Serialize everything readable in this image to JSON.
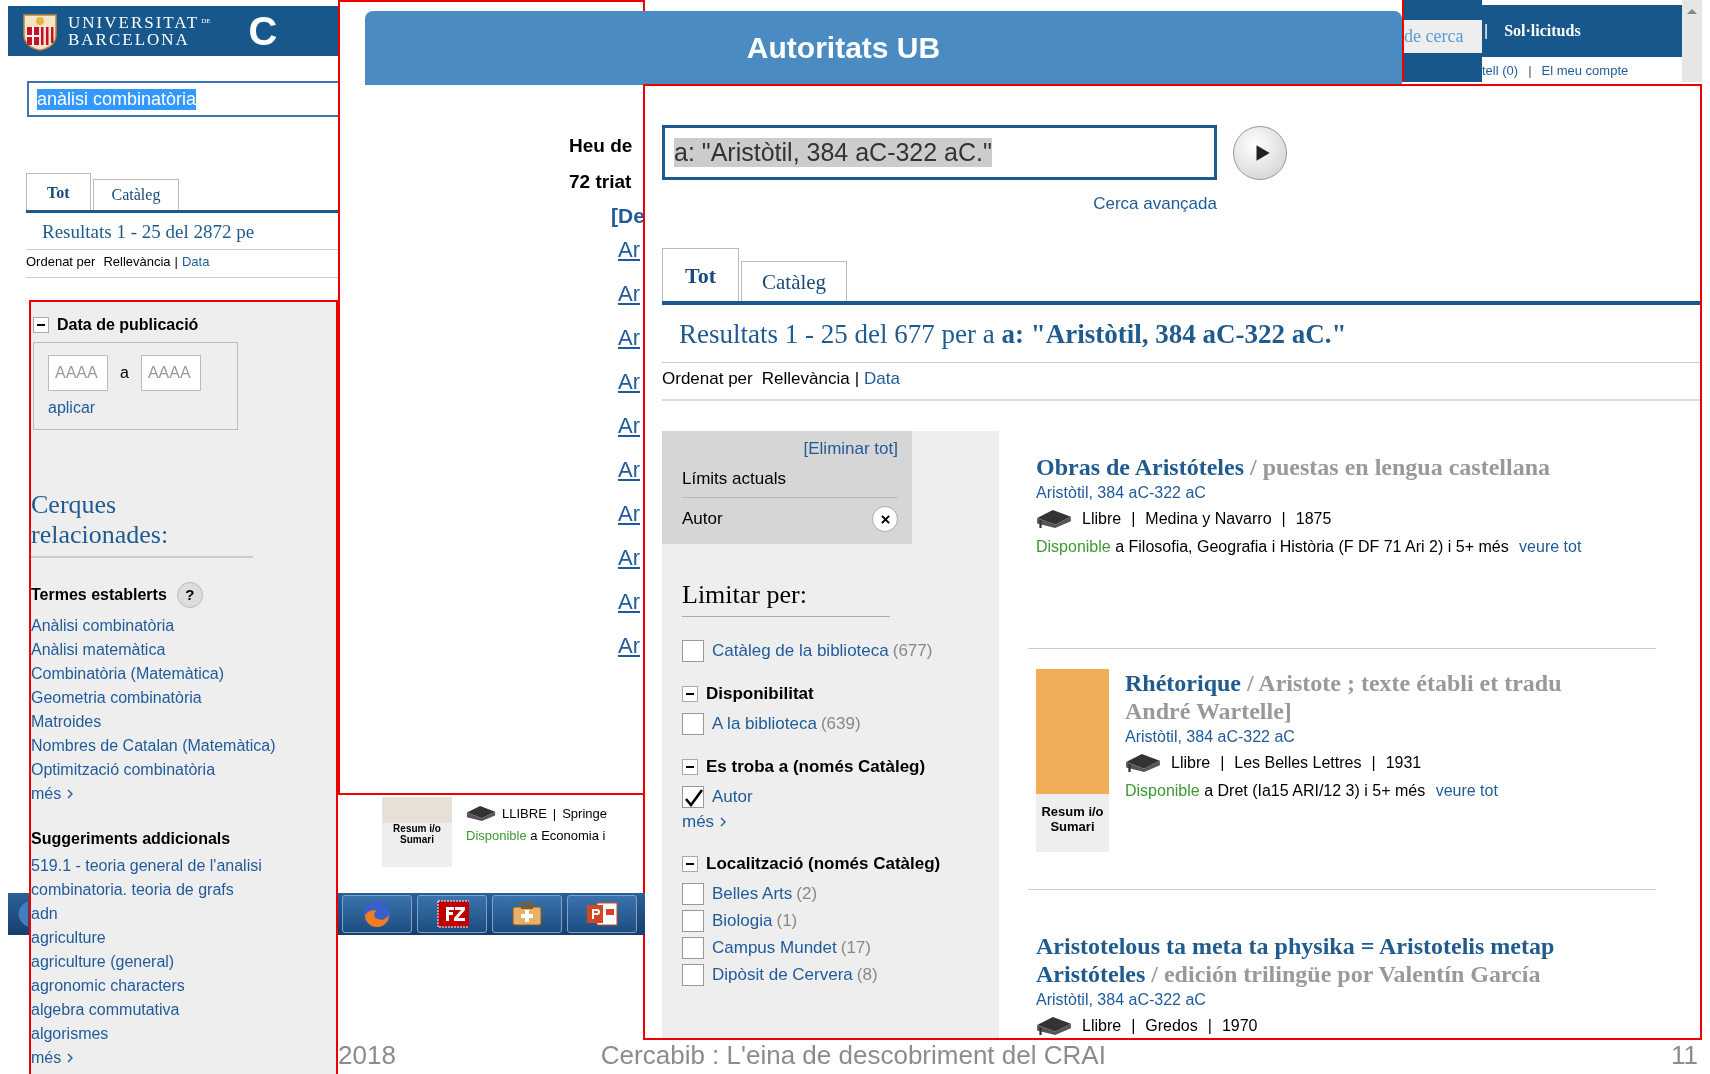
{
  "left_window": {
    "logo_lines": [
      "UNIVERSITAT",
      "DE",
      "BARCELONA"
    ],
    "brand_cut": "C",
    "search": {
      "value": "anàlisi combinatòria",
      "text_selected": true
    },
    "tabs": [
      {
        "label": "Tot",
        "selected": true
      },
      {
        "label": "Catàleg",
        "selected": false
      }
    ],
    "results_heading": "Resultats 1 - 25 del 2872 pe",
    "sort": {
      "label": "Ordenat per",
      "separator": "|",
      "options": [
        {
          "label": "Rellevància",
          "selected": true
        },
        {
          "label": "Data",
          "selected": false
        }
      ]
    },
    "date_facet": {
      "title": "Data de publicació",
      "expanded": true,
      "from_placeholder": "AAAA",
      "between": "a",
      "to_placeholder": "AAAA",
      "apply": "aplicar"
    },
    "related_heading": "Cerques relacionades:",
    "related_groups": [
      {
        "title": "Termes establerts",
        "help": "?",
        "links": [
          "Anàlisi combinatòria",
          "Anàlisi matemàtica",
          "Combinatòria (Matemàtica)",
          "Geometria combinatòria",
          "Matroides",
          "Nombres de Catalan (Matemàtica)",
          "Optimització combinatòria"
        ],
        "more": "més"
      },
      {
        "title": "Suggeriments addicionals",
        "links": [
          "519.1 - teoria general de l'analisi combinatoria. teoria de grafs",
          "adn",
          "agriculture",
          "agriculture (general)",
          "agronomic characters",
          "algebra commutativa",
          "algorismes"
        ],
        "more": "més"
      }
    ]
  },
  "middle_window": {
    "title": "Autoritats UB",
    "lines": [
      "Heu de",
      "72 triat"
    ],
    "bracket_link": "[De",
    "links": [
      "Ar",
      "Ar",
      "Ar",
      "Ar",
      "Ar",
      "Ar",
      "Ar",
      "Ar",
      "Ar",
      "Ar"
    ],
    "record": {
      "cover_caption": "Resum i/o Sumari",
      "meta": [
        "LLIBRE",
        "|",
        "Springe"
      ],
      "availability": "Disponible",
      "location": "a Economia i"
    }
  },
  "top_right_window": {
    "tab": "de cerca",
    "separator": "|",
    "menu": "Sol·licituds",
    "links": [
      "tell (0)",
      "|",
      "El meu compte"
    ]
  },
  "main_window": {
    "search": {
      "value": "a: \"Aristòtil, 384 aC-322 aC.\"",
      "text_selected": true
    },
    "advanced": "Cerca avançada",
    "tabs": [
      {
        "label": "Tot",
        "selected": true
      },
      {
        "label": "Catàleg",
        "selected": false
      }
    ],
    "results_heading": "Resultats 1 - 25 del 677 per a **a: \"Aristòtil, 384 aC-322 aC.\"**",
    "sort": {
      "label": "Ordenat per",
      "separator": "|",
      "options": [
        {
          "label": "Rellevància",
          "selected": true
        },
        {
          "label": "Data",
          "selected": false
        }
      ]
    },
    "current_limits": {
      "remove_all": "[Eliminar tot]",
      "title": "Límits actuals",
      "items": [
        "Autor"
      ]
    },
    "limit_heading": "Limitar per:",
    "facet_groups": [
      {
        "items": [
          {
            "label": "Catàleg de la biblioteca",
            "count": "(677)",
            "checked": false
          }
        ]
      },
      {
        "title": "Disponibilitat",
        "expanded": true,
        "items": [
          {
            "label": "A la biblioteca",
            "count": "(639)",
            "checked": false
          }
        ]
      },
      {
        "title": "Es troba a (només Catàleg)",
        "expanded": true,
        "items": [
          {
            "label": "Autor",
            "checked": true
          }
        ],
        "more": "més"
      },
      {
        "title": "Localització (només Catàleg)",
        "expanded": true,
        "items": [
          {
            "label": "Belles Arts",
            "count": "(2)",
            "checked": false
          },
          {
            "label": "Biologia",
            "count": "(1)",
            "checked": false
          },
          {
            "label": "Campus Mundet",
            "count": "(17)",
            "checked": false
          },
          {
            "label": "Dipòsit de Cervera",
            "count": "(8)",
            "checked": false
          }
        ]
      }
    ],
    "results": [
      {
        "title_lines": [
          [
            {
              "kind": "title",
              "text": "Obras de Aristóteles"
            },
            {
              "kind": "subtitle",
              "text": " / puestas en lengua castellana"
            }
          ]
        ],
        "author": "Aristòtil, 384 aC-322 aC",
        "meta": [
          "Llibre",
          "|",
          "Medina y Navarro",
          "|",
          "1875"
        ],
        "availability": "Disponible",
        "location": "a Filosofia, Geografia i Història (F DF 71 Ari 2) i 5+ més",
        "see_all": "veure tot"
      },
      {
        "cover_caption": "Resum i/o Sumari",
        "title_lines": [
          [
            {
              "kind": "title",
              "text": "Rhétorique"
            },
            {
              "kind": "subtitle",
              "text": " / Aristote ; texte établi et tradu"
            }
          ],
          [
            {
              "kind": "subtitle",
              "text": "André Wartelle]"
            }
          ]
        ],
        "author": "Aristòtil, 384 aC-322 aC",
        "meta": [
          "Llibre",
          "|",
          "Les Belles Lettres",
          "|",
          "1931"
        ],
        "availability": "Disponible",
        "location": "a Dret (Ia15 ARI/12 3) i 5+ més",
        "see_all": "veure tot"
      },
      {
        "title_lines": [
          [
            {
              "kind": "title",
              "text": "Aristotelous ta meta ta physika = Aristotelis metap"
            }
          ],
          [
            {
              "kind": "title",
              "text": "Aristóteles"
            },
            {
              "kind": "subtitle",
              "text": " / edición trilingüe por Valentín García"
            }
          ]
        ],
        "author": "Aristòtil, 384 aC-322 aC",
        "meta": [
          "Llibre",
          "|",
          "Gredos",
          "|",
          "1970"
        ]
      }
    ]
  },
  "slide_footer": {
    "year": "2018",
    "title": "Cercabib : L'eina de descobriment del CRAI",
    "page": "11"
  }
}
